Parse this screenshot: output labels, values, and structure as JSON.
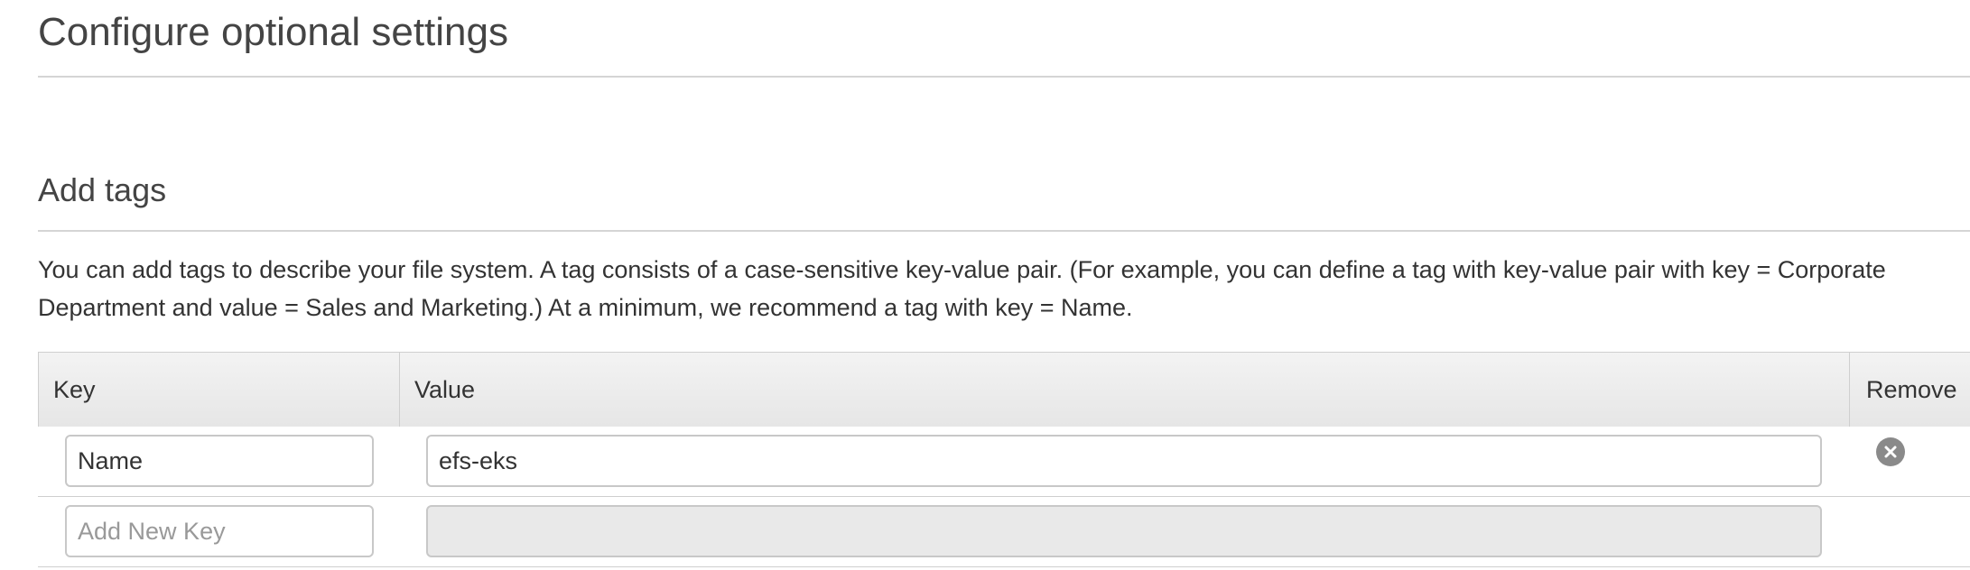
{
  "page": {
    "title": "Configure optional settings"
  },
  "tags_section": {
    "title": "Add tags",
    "description": "You can add tags to describe your file system. A tag consists of a case-sensitive key-value pair. (For example, you can define a tag with key-value pair with key = Corporate Department and value = Sales and Marketing.) At a minimum, we recommend a tag with key = Name.",
    "columns": {
      "key": "Key",
      "value": "Value",
      "remove": "Remove"
    },
    "rows": [
      {
        "key": "Name",
        "value": "efs-eks",
        "remove_icon": "close-circle-icon"
      }
    ],
    "new_row": {
      "key_placeholder": "Add New Key",
      "value": ""
    }
  },
  "colors": {
    "heading": "#444444",
    "text": "#333333",
    "header_bg": "#e6e6e6",
    "border": "#cfcfcf",
    "remove_icon": "#8a8a8a"
  }
}
